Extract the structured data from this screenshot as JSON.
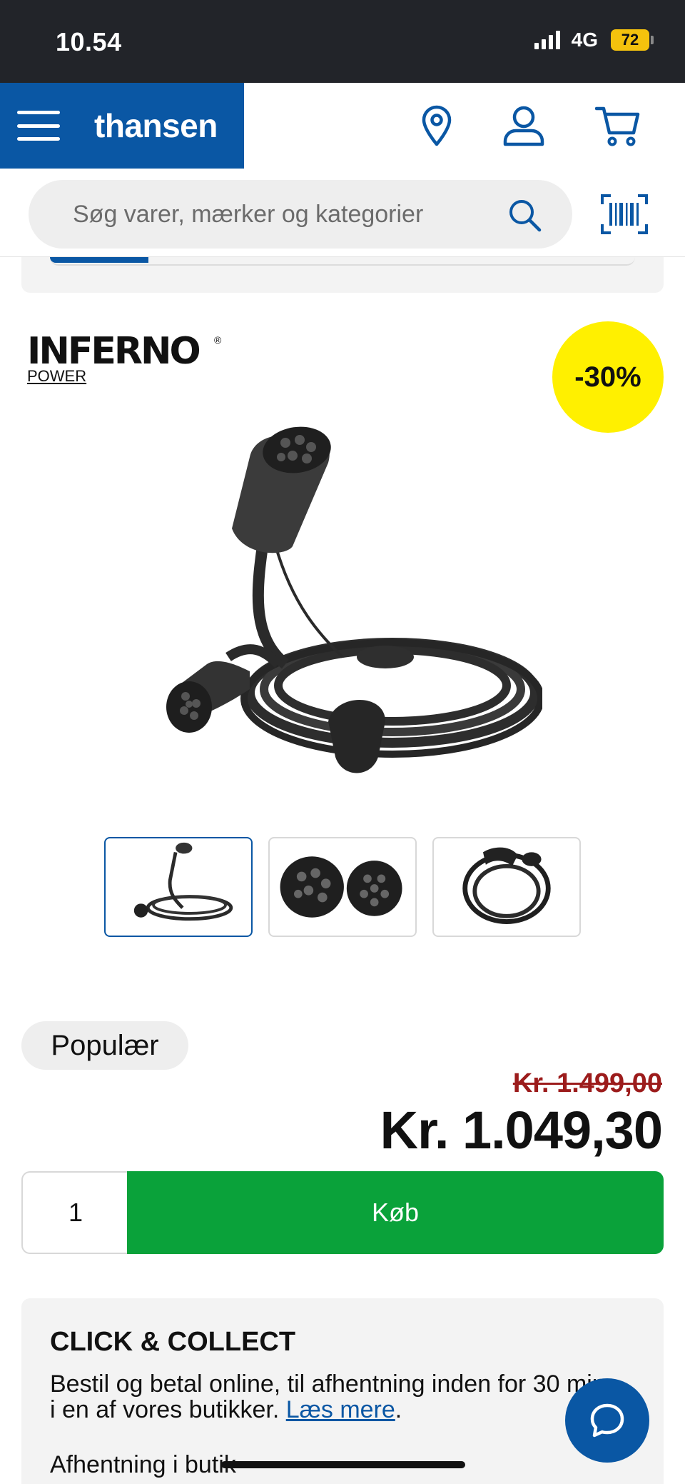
{
  "status_bar": {
    "time": "10.54",
    "network": "4G",
    "battery": "72"
  },
  "header": {
    "logo": "thansen"
  },
  "search": {
    "placeholder": "Søg varer, mærker og kategorier"
  },
  "product": {
    "brand_name": "INFERNO",
    "brand_sub": "POWER",
    "brand_reg": "®",
    "discount": "-30%",
    "thumbnails_count": 3,
    "active_thumbnail": 0
  },
  "pricing": {
    "badge": "Populær",
    "old_price": "Kr. 1.499,00",
    "new_price": "Kr. 1.049,30"
  },
  "purchase": {
    "quantity": "1",
    "buy_label": "Køb"
  },
  "click_collect": {
    "title": "CLICK & COLLECT",
    "text": "Bestil og betal online, til afhentning inden for 30 min. i en af vores butikker.",
    "link": "Læs mere",
    "link_suffix": ".",
    "pickup": "Afhentning i butik"
  },
  "colors": {
    "brand_blue": "#0a57a4",
    "buy_green": "#0aa23a",
    "badge_yellow": "#fff000",
    "old_price_red": "#9c1c1c"
  }
}
